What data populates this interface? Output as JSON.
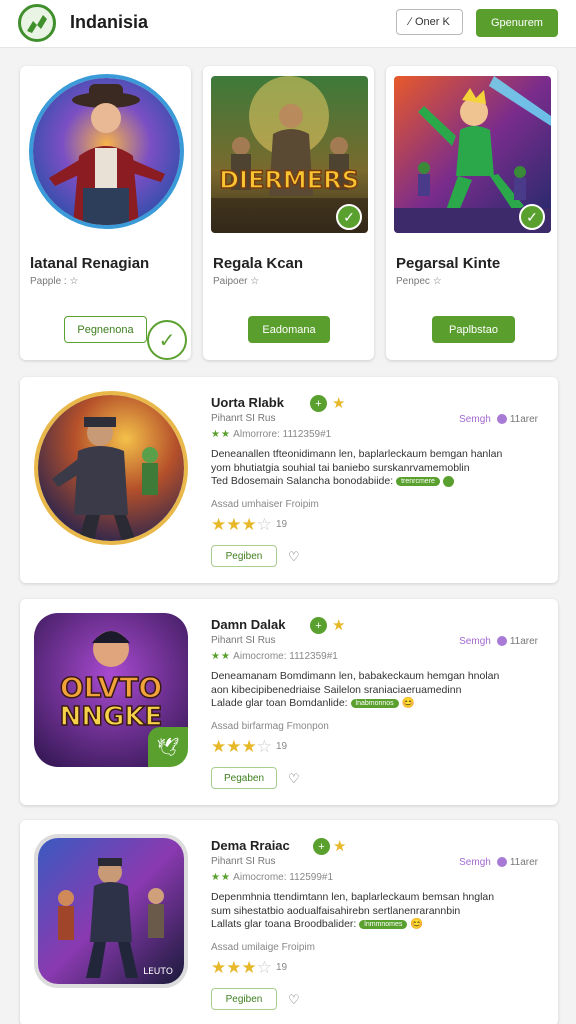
{
  "header": {
    "title": "Indanisia",
    "outline_button": "Oner K",
    "green_button": "Gpenurem"
  },
  "featured": [
    {
      "title": "latanal Renagian",
      "sub": "Papple :",
      "button": "Pegnenona",
      "button_style": "outline"
    },
    {
      "title": "Regala Kcan",
      "sub": "Paipoer",
      "button": "Eadomana",
      "button_style": "solid",
      "art_text": "DIERMERS"
    },
    {
      "title": "Pegarsal Kinte",
      "sub": "Penpec",
      "button": "Paplbstao",
      "button_style": "solid"
    }
  ],
  "listings": [
    {
      "title": "Uorta Rlabk",
      "sub1": "Pihanrt SI Rus",
      "sub2": "Almorrore:   1112359#1",
      "meta_left": "Semgh",
      "meta_right": "11arer",
      "desc1": "Deneanallen tfteonidimann len, baplarleckaum bemgan hanlan",
      "desc2": "yom bhutiatgia souhial tai baniebo surskanrvamemoblin",
      "desc3": "Ted Bdosemain Salancha bonodabiide:",
      "tag": "trenrcmere",
      "note": "Assad umhaiser Froipim",
      "rating": 3.5,
      "count": "19",
      "button": "Pegiben"
    },
    {
      "title": "Damn Dalak",
      "sub1": "Pihanrt SI Rus",
      "sub2": "Aimocrome:   1112359#1",
      "meta_left": "Semgh",
      "meta_right": "11arer",
      "desc1": "Deneamanam Bomdimann len, babakeckaum hemgan hnolan",
      "desc2": "aon kibecipibenedriaise Sailelon sraniaciaeruamedinn",
      "desc3": "Lalade  glar toan Bomdanlide:",
      "tag": "lnabmonnos",
      "note": "Assad birfarmag Fmonpon",
      "rating": 3,
      "count": "19",
      "button": "Pegaben",
      "art_line1": "OLVTO",
      "art_line2": "NNGKE"
    },
    {
      "title": "Dema Rraiac",
      "sub1": "Pihanrt SI Rus",
      "sub2": "Aimocrome:   112599#1",
      "meta_left": "Semgh",
      "meta_right": "11arer",
      "desc1": "Depenmhnia ttendimtann len, baplarleckaum bemsan hnglan",
      "desc2": "sum sihestatbio aodualfaisahirebn sertlanenrarannbin",
      "desc3": "Lallats  glar toana Broodbalider:",
      "tag": "lnmmnomes",
      "note": "Assad umilaige Froipim",
      "rating": 3,
      "count": "19",
      "button": "Pegiben",
      "art_text": "LEUTO"
    }
  ]
}
